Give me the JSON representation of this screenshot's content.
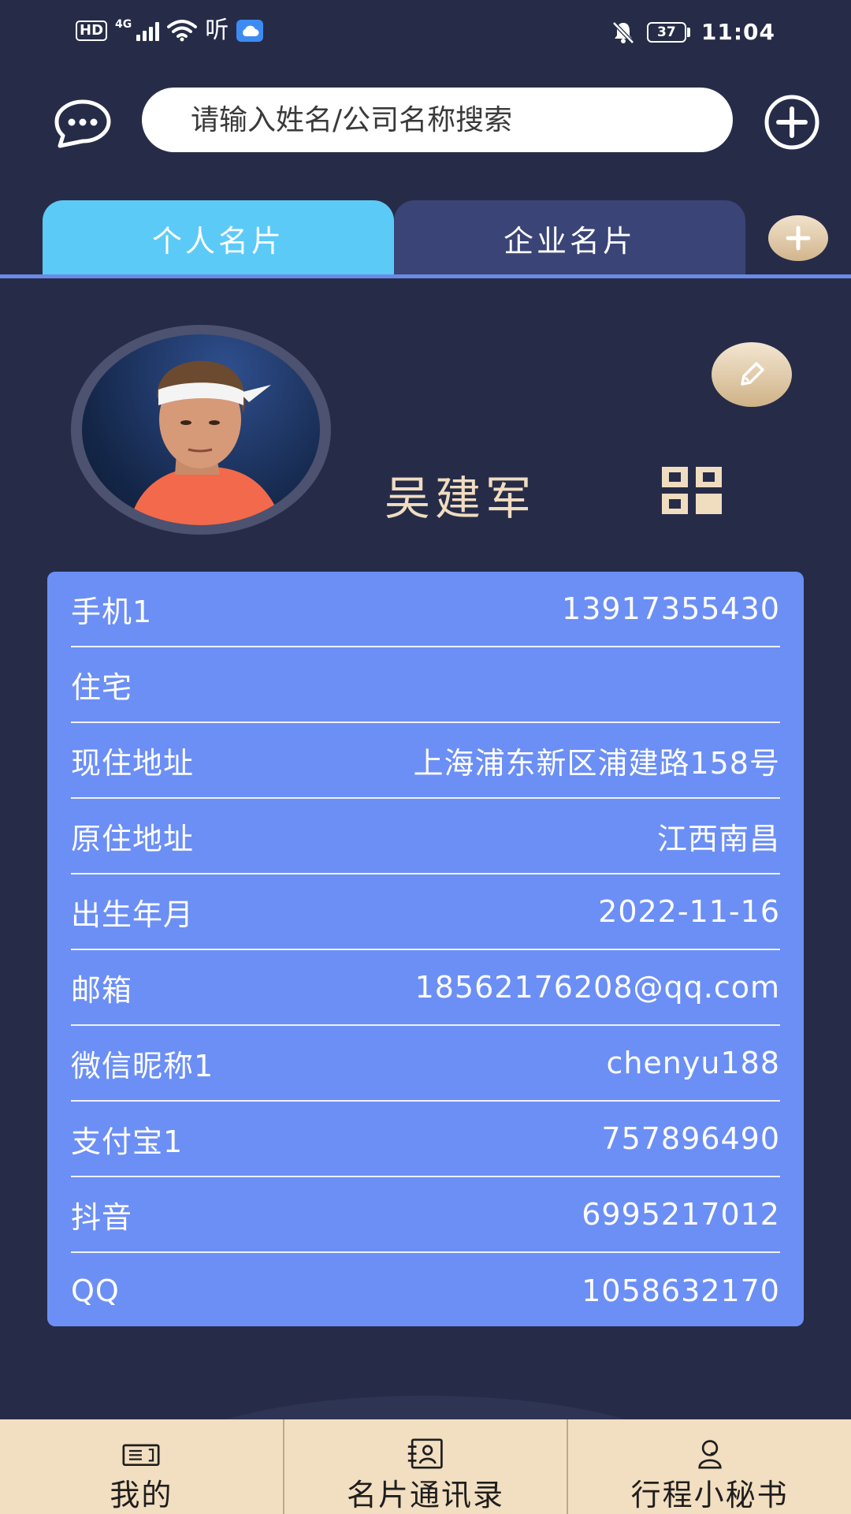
{
  "status_bar": {
    "hd": "HD",
    "network": "4G",
    "listen": "听",
    "battery": "37",
    "time": "11:04"
  },
  "header": {
    "search_placeholder": "请输入姓名/公司名称搜索",
    "chat_icon": "chat-bubble-icon",
    "add_icon": "plus-circle-icon"
  },
  "tabs": [
    {
      "label": "个人名片",
      "active": true
    },
    {
      "label": "企业名片",
      "active": false
    }
  ],
  "profile": {
    "name": "吴建军",
    "edit_icon": "pencil-icon",
    "qr_icon": "qr-code-icon"
  },
  "info": [
    {
      "label": "手机1",
      "value": "13917355430"
    },
    {
      "label": "住宅",
      "value": ""
    },
    {
      "label": "现住地址",
      "value": "上海浦东新区浦建路158号"
    },
    {
      "label": "原住地址",
      "value": "江西南昌"
    },
    {
      "label": "出生年月",
      "value": "2022-11-16"
    },
    {
      "label": "邮箱",
      "value": "18562176208@qq.com"
    },
    {
      "label": "微信昵称1",
      "value": "chenyu188"
    },
    {
      "label": "支付宝1",
      "value": "757896490"
    },
    {
      "label": "抖音",
      "value": "6995217012"
    },
    {
      "label": "QQ",
      "value": "1058632170"
    }
  ],
  "bottom_nav": [
    {
      "label": "我的",
      "icon": "card-icon"
    },
    {
      "label": "名片通讯录",
      "icon": "contact-card-icon"
    },
    {
      "label": "行程小秘书",
      "icon": "person-headset-icon"
    }
  ],
  "colors": {
    "background": "#262c48",
    "tab_active": "#5ccaf6",
    "tab_inactive": "#3a4476",
    "card": "#6c8ff5",
    "name_gold": "#f0ddc0",
    "nav_bg": "#f2dec0"
  }
}
